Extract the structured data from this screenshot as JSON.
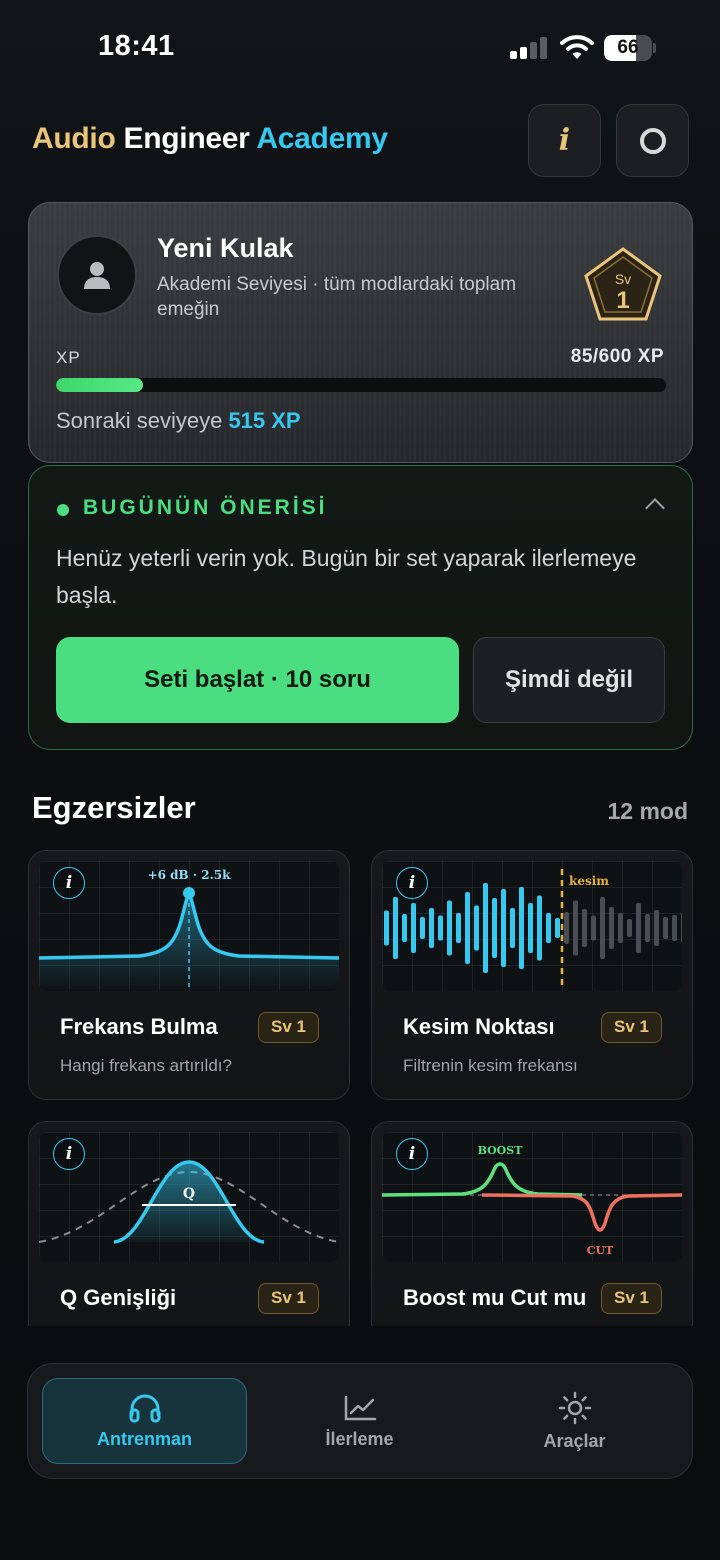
{
  "status_bar": {
    "time": "18:41",
    "battery": "66",
    "battery_level": 0.66
  },
  "header": {
    "title_part1": "Audio",
    "title_part2": "Engineer",
    "title_part3": "Academy",
    "info_button_icon": "info-icon",
    "settings_button_icon": "ring-icon"
  },
  "profile": {
    "name": "Yeni Kulak",
    "subtitle": "Akademi Seviyesi · tüm modlardaki toplam emeğin",
    "badge_prefix": "Sv",
    "badge_level": "1",
    "xp_label": "XP",
    "xp_value": "85/600 XP",
    "xp_progress": 0.142,
    "next_prefix": "Sonraki seviyeye",
    "next_xp": "515 XP"
  },
  "recommendation": {
    "title": "BUGÜNÜN ÖNERİSİ",
    "body": "Henüz yeterli verin yok. Bugün bir set yaparak ilerlemeye başla.",
    "start_label": "Seti başlat · 10 soru",
    "later_label": "Şimdi değil"
  },
  "exercises": {
    "title": "Egzersizler",
    "count": "12 mod",
    "items": [
      {
        "title": "Frekans Bulma",
        "level": "Sv 1",
        "subtitle": "Hangi frekans artırıldı?",
        "viz_label": "+6 dB · 2.5k"
      },
      {
        "title": "Kesim Noktası",
        "level": "Sv 1",
        "subtitle": "Filtrenin kesim frekansı",
        "viz_label": "kesim"
      },
      {
        "title": "Q Genişliği",
        "level": "Sv 1",
        "subtitle": "",
        "viz_label": "Q"
      },
      {
        "title": "Boost mu Cut mu",
        "level": "Sv 1",
        "subtitle": "",
        "viz_label_boost": "BOOST",
        "viz_label_cut": "CUT"
      }
    ]
  },
  "nav": {
    "items": [
      {
        "label": "Antrenman",
        "icon": "headphones-icon",
        "active": true
      },
      {
        "label": "İlerleme",
        "icon": "chart-line-icon",
        "active": false
      },
      {
        "label": "Araçlar",
        "icon": "sun-gear-icon",
        "active": false
      }
    ]
  },
  "colors": {
    "accent_cyan": "#36c9f0",
    "accent_green": "#4ade80",
    "accent_gold": "#e9c57a",
    "cut_red": "#f07060"
  }
}
